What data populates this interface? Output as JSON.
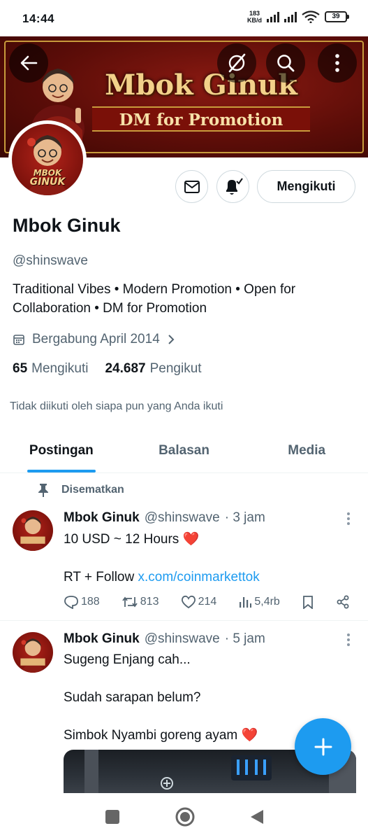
{
  "status_bar": {
    "time": "14:44",
    "net_speed_value": "183",
    "net_speed_unit": "KB/d",
    "battery": "39"
  },
  "banner": {
    "title": "Mbok Ginuk",
    "subtitle": "DM for Promotion",
    "buttons": [
      "back-arrow-icon",
      "grok-icon",
      "search-icon",
      "more-vertical-icon"
    ]
  },
  "avatar": {
    "logo_line1": "MBOK",
    "logo_line2": "GINUK"
  },
  "actions": {
    "message_icon": "mail-icon",
    "notify_icon": "bell-check-icon",
    "follow_label": "Mengikuti"
  },
  "profile": {
    "name": "Mbok Ginuk",
    "handle": "@shinswave",
    "bio": "Traditional Vibes • Modern Promotion • Open for Collaboration • DM for Promotion",
    "joined": "Bergabung April 2014",
    "following_count": "65",
    "following_label": "Mengikuti",
    "followers_count": "24.687",
    "followers_label": "Pengikut",
    "followed_note": "Tidak diikuti oleh siapa pun yang Anda ikuti"
  },
  "tabs": [
    {
      "label": "Postingan",
      "active": true
    },
    {
      "label": "Balasan",
      "active": false
    },
    {
      "label": "Media",
      "active": false
    }
  ],
  "posts": [
    {
      "pinned_label": "Disematkan",
      "name": "Mbok Ginuk",
      "handle": "@shinswave",
      "time": "· 3 jam",
      "line1": "10 USD ~ 12 Hours ❤️",
      "line2_prefix": "RT + Follow ",
      "link": "x.com/coinmarkettok",
      "replies": "188",
      "reposts": "813",
      "likes": "214",
      "views": "5,4rb"
    },
    {
      "name": "Mbok Ginuk",
      "handle": "@shinswave",
      "time": "· 5 jam",
      "line1": "Sugeng Enjang cah...",
      "line2": "Sudah sarapan belum?",
      "line3": "Simbok Nyambi goreng ayam ❤️"
    }
  ],
  "colors": {
    "accent": "#1d9bf0",
    "text_primary": "#0f1419",
    "text_secondary": "#536471",
    "banner_red": "#7a1008",
    "banner_gold": "#f2d18a"
  }
}
